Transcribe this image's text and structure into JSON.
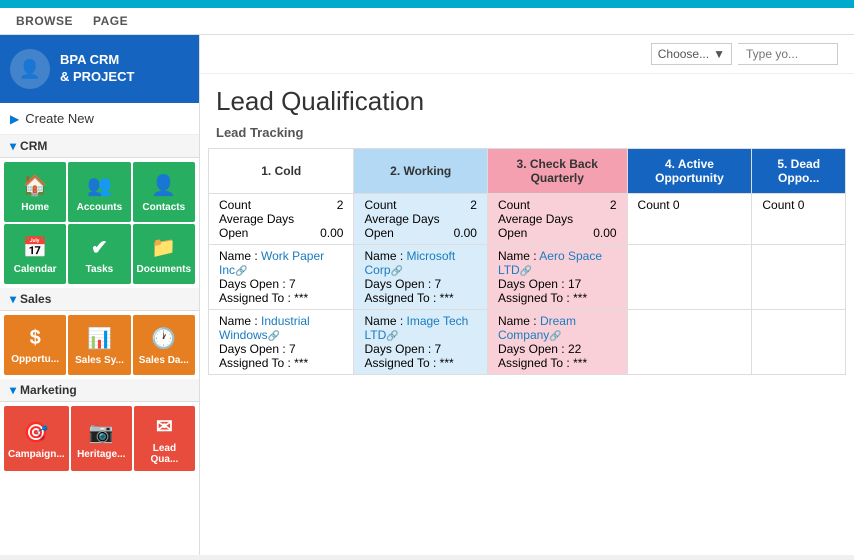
{
  "topbar": {},
  "menubar": {
    "items": [
      "BROWSE",
      "PAGE"
    ]
  },
  "sidebar": {
    "logo": {
      "title": "BPA CRM\n& PROJECT",
      "icon": "👤"
    },
    "create_new": "Create New",
    "sections": [
      {
        "name": "CRM",
        "tiles": [
          {
            "label": "Home",
            "icon": "🏠",
            "class": "tile-home"
          },
          {
            "label": "Accounts",
            "icon": "👥",
            "class": "tile-accounts"
          },
          {
            "label": "Contacts",
            "icon": "👤",
            "class": "tile-contacts"
          },
          {
            "label": "Calendar",
            "icon": "📅",
            "class": "tile-calendar"
          },
          {
            "label": "Tasks",
            "icon": "✔",
            "class": "tile-tasks"
          },
          {
            "label": "Documents",
            "icon": "📁",
            "class": "tile-documents"
          }
        ]
      },
      {
        "name": "Sales",
        "tiles": [
          {
            "label": "Opportu...",
            "icon": "$",
            "class": "tile-opps"
          },
          {
            "label": "Sales Sy...",
            "icon": "📊",
            "class": "tile-sales-sys"
          },
          {
            "label": "Sales Da...",
            "icon": "🕐",
            "class": "tile-sales-da"
          }
        ]
      },
      {
        "name": "Marketing",
        "tiles": [
          {
            "label": "Campaign...",
            "icon": "🎯",
            "class": "tile-campaigns"
          },
          {
            "label": "Heritage...",
            "icon": "📷",
            "class": "tile-heritage"
          },
          {
            "label": "Lead Qua...",
            "icon": "✉",
            "class": "tile-lead"
          }
        ]
      }
    ]
  },
  "header": {
    "dropdown": {
      "label": "Choose...",
      "placeholder": "Type yo..."
    }
  },
  "main": {
    "page_title": "Lead Qualification",
    "section_title": "Lead Tracking",
    "table": {
      "columns": [
        {
          "id": "cold",
          "label": "1. Cold",
          "style": "cold"
        },
        {
          "id": "working",
          "label": "2. Working",
          "style": "working"
        },
        {
          "id": "quarterly",
          "label": "3. Check Back\nQuarterly",
          "style": "quarterly"
        },
        {
          "id": "active",
          "label": "4. Active Opportunity",
          "style": "active"
        },
        {
          "id": "dead",
          "label": "5. Dead Oppo...",
          "style": "dead"
        }
      ],
      "stats": [
        {
          "count": 2,
          "avg_days": "0.00",
          "style": "cold"
        },
        {
          "count": 2,
          "avg_days": "0.00",
          "style": "working"
        },
        {
          "count": 2,
          "avg_days": "0.00",
          "style": "quarterly"
        },
        {
          "count": 0,
          "avg_days": null,
          "style": "active"
        },
        {
          "count": 0,
          "avg_days": null,
          "style": "dead"
        }
      ],
      "items": [
        [
          {
            "name": "Work Paper Inc",
            "link": true,
            "days_open": 7,
            "assigned": "***",
            "style": "cold"
          },
          {
            "name": "Microsoft Corp",
            "link": true,
            "days_open": 7,
            "assigned": "***",
            "style": "working"
          },
          {
            "name": "Aero Space LTD",
            "link": true,
            "days_open": 17,
            "assigned": "***",
            "style": "quarterly"
          },
          null,
          null
        ],
        [
          {
            "name": "Industrial Windows",
            "link": true,
            "days_open": 7,
            "assigned": "***",
            "style": "cold"
          },
          {
            "name": "Image Tech LTD",
            "link": true,
            "days_open": 7,
            "assigned": "***",
            "style": "working"
          },
          {
            "name": "Dream Company",
            "link": true,
            "days_open": 22,
            "assigned": "***",
            "style": "quarterly"
          },
          null,
          null
        ]
      ],
      "labels": {
        "count": "Count",
        "average_days": "Average Days",
        "open": "Open",
        "name_prefix": "Name : ",
        "days_open_prefix": "Days Open : ",
        "assigned_prefix": "Assigned To : "
      }
    }
  }
}
